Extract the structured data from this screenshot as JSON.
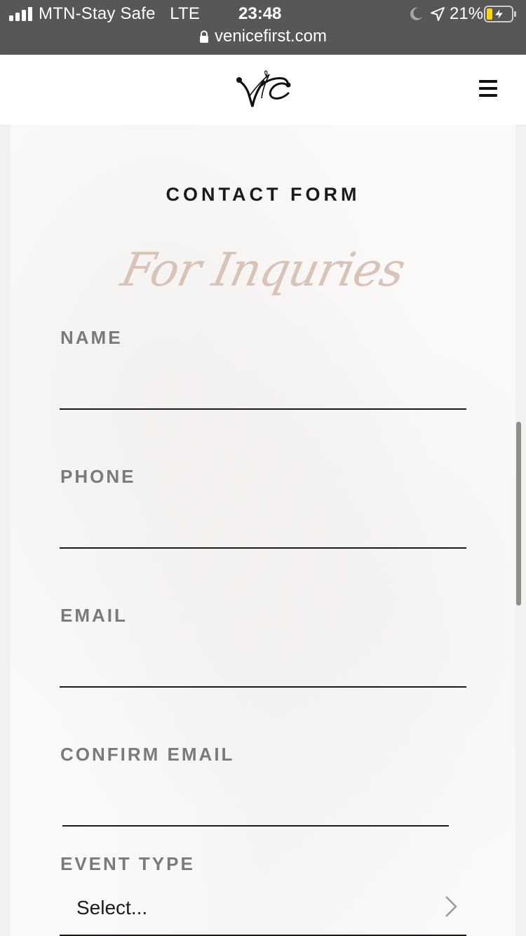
{
  "status_bar": {
    "carrier": "MTN-Stay Safe",
    "network": "LTE",
    "time": "23:48",
    "battery_percent": "21%",
    "icons": [
      "signal-icon",
      "moon-icon",
      "location-arrow-icon",
      "battery-charging-icon"
    ]
  },
  "browser": {
    "url": "venicefirst.com",
    "icon": "lock-icon"
  },
  "header": {
    "logo_icon": "venice-first-monogram-icon",
    "menu_icon": "hamburger-menu-icon"
  },
  "form": {
    "title": "CONTACT FORM",
    "script_heading": "For Inquries",
    "fields": [
      {
        "label": "NAME",
        "value": ""
      },
      {
        "label": "PHONE",
        "value": ""
      },
      {
        "label": "EMAIL",
        "value": ""
      },
      {
        "label": "CONFIRM EMAIL",
        "value": ""
      }
    ],
    "event_type": {
      "label": "EVENT TYPE",
      "selected": "Select...",
      "icon": "chevron-right-icon"
    }
  },
  "colors": {
    "status_bar_bg": "#575757",
    "script_accent": "#d7c3b7",
    "label_gray": "#7a7a7a",
    "battery_yellow": "#ffd60a"
  }
}
